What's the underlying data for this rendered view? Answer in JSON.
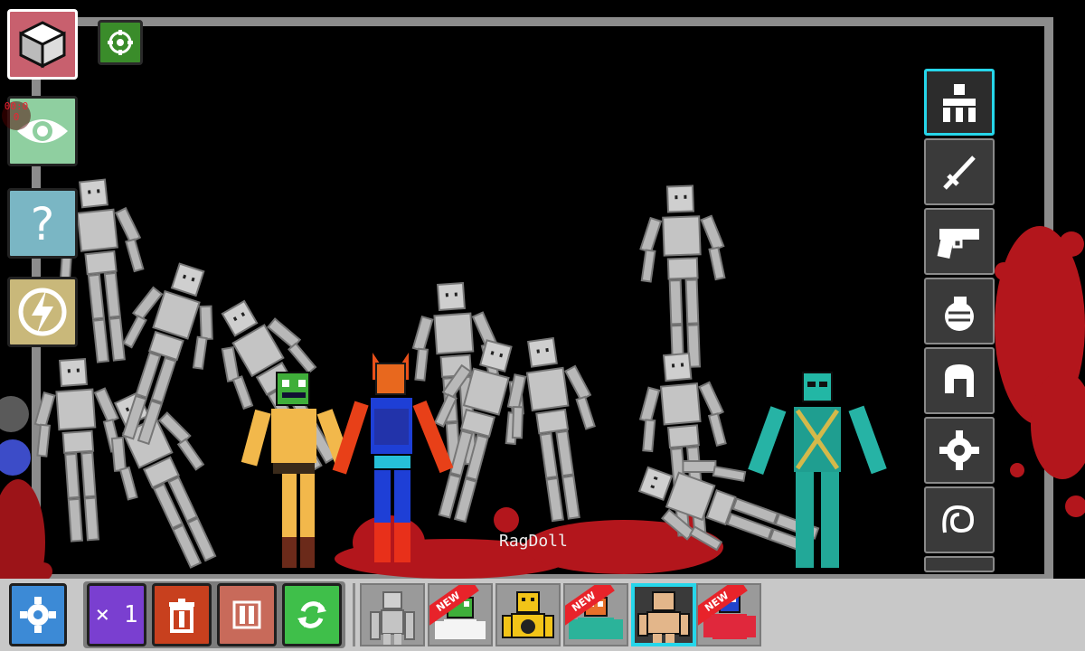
{
  "hud": {
    "timer": "00:0 0",
    "ragdoll_label": "RagDoll",
    "multiplier_label": "× 1"
  },
  "left_buttons": [
    {
      "name": "spawn-mode-button",
      "icon": "isometric-cube-icon"
    },
    {
      "name": "visibility-button",
      "icon": "eye-icon"
    },
    {
      "name": "help-button",
      "icon": "question-mark-icon"
    },
    {
      "name": "power-button",
      "icon": "lightning-bolt-icon"
    }
  ],
  "right_toolbar": [
    {
      "name": "tool-figures",
      "icon": "figures-icon",
      "active": true
    },
    {
      "name": "tool-melee",
      "icon": "sword-icon",
      "active": false
    },
    {
      "name": "tool-firearms",
      "icon": "pistol-icon",
      "active": false
    },
    {
      "name": "tool-explosives",
      "icon": "grenade-icon",
      "active": false
    },
    {
      "name": "tool-armor",
      "icon": "helmet-icon",
      "active": false
    },
    {
      "name": "tool-machinery",
      "icon": "gear-icon",
      "active": false
    },
    {
      "name": "tool-misc",
      "icon": "swirl-icon",
      "active": false
    }
  ],
  "bottom_controls": [
    {
      "name": "settings-button",
      "icon": "gear-icon"
    },
    {
      "name": "time-scale-button",
      "icon": "multiplier-icon"
    },
    {
      "name": "delete-button",
      "icon": "trash-icon"
    },
    {
      "name": "pause-button",
      "icon": "pause-icon"
    },
    {
      "name": "reset-button",
      "icon": "refresh-icon"
    }
  ],
  "item_bar": [
    {
      "name": "item-gray-ragdoll",
      "new": false,
      "selected": false
    },
    {
      "name": "item-green-creature",
      "new": true,
      "badge": "NEW",
      "selected": false
    },
    {
      "name": "item-yellow-robot",
      "new": false,
      "selected": false
    },
    {
      "name": "item-orange-character",
      "new": true,
      "badge": "NEW",
      "selected": false
    },
    {
      "name": "item-human-ragdoll",
      "new": false,
      "selected": true
    },
    {
      "name": "item-blue-red-character",
      "new": true,
      "badge": "NEW",
      "selected": false
    }
  ],
  "colors": {
    "accent": "#26d6ea",
    "blood": "#b3161c",
    "frame": "#8c8c8c",
    "bottom_bar": "#c8c8c8",
    "ragdoll_gray": "#c4c4c4"
  }
}
